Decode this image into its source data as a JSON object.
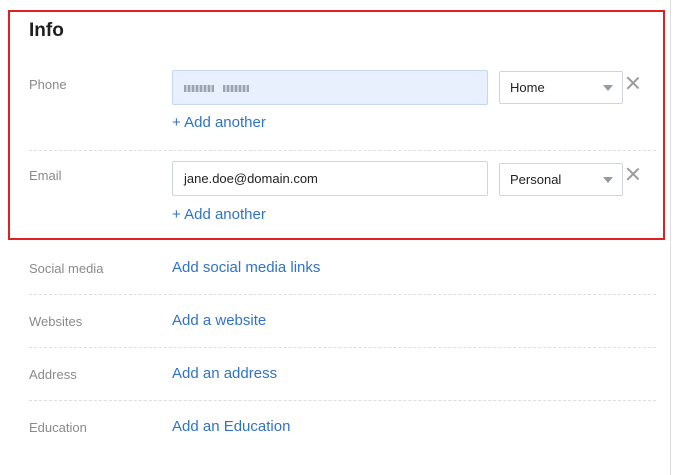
{
  "section": {
    "title": "Info"
  },
  "phone": {
    "label": "Phone",
    "value": "",
    "type_selected": "Home",
    "add_another": "+ Add another"
  },
  "email": {
    "label": "Email",
    "value": "jane.doe@domain.com",
    "type_selected": "Personal",
    "add_another": "+ Add another"
  },
  "social_media": {
    "label": "Social media",
    "action": "Add social media links"
  },
  "websites": {
    "label": "Websites",
    "action": "Add a website"
  },
  "address": {
    "label": "Address",
    "action": "Add an address"
  },
  "education": {
    "label": "Education",
    "action": "Add an Education"
  },
  "colors": {
    "highlight_border": "#e02020",
    "link": "#2f73c9",
    "focused_input_bg": "#e8f0fd"
  }
}
